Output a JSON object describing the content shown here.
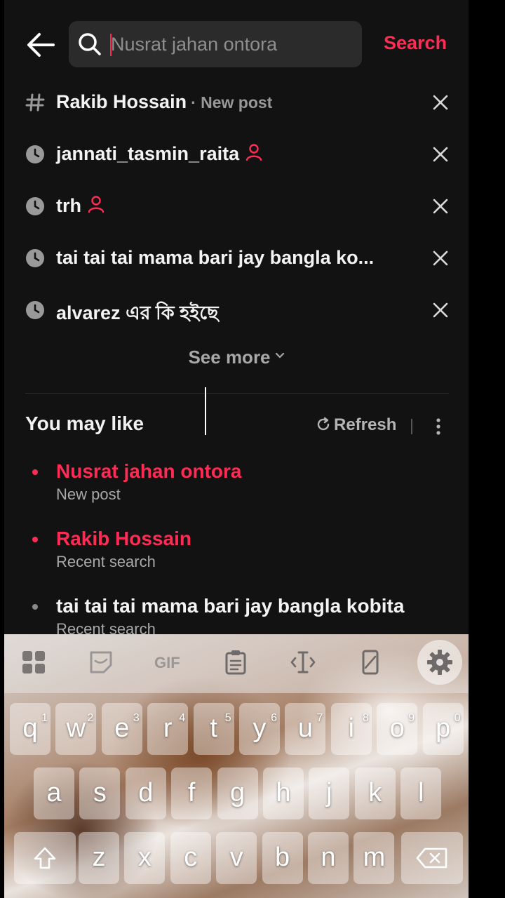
{
  "search": {
    "placeholder": "Nusrat jahan ontora",
    "button_label": "Search"
  },
  "history": [
    {
      "icon": "hashtag-icon",
      "text": "Rakib Hossain",
      "sub": "· New post",
      "has_user_icon": false
    },
    {
      "icon": "clock-icon",
      "text": "jannati_tasmin_raita",
      "sub": "",
      "has_user_icon": true
    },
    {
      "icon": "clock-icon",
      "text": "trh",
      "sub": "",
      "has_user_icon": true
    },
    {
      "icon": "clock-icon",
      "text": "tai tai tai mama bari jay bangla ko...",
      "sub": "",
      "has_user_icon": false
    },
    {
      "icon": "clock-icon",
      "text": "alvarez এর কি হইছে",
      "sub": "",
      "has_user_icon": false
    }
  ],
  "see_more_label": "See more",
  "you_may_like": {
    "title": "You may like",
    "refresh_label": "Refresh",
    "items": [
      {
        "title": "Nusrat jahan ontora",
        "sub": "New post",
        "highlight": true
      },
      {
        "title": "Rakib Hossain",
        "sub": "Recent search",
        "highlight": true
      },
      {
        "title": "tai tai tai mama bari jay bangla kobita",
        "sub": "Recent search",
        "highlight": false
      }
    ]
  },
  "keyboard": {
    "toolbar": [
      "apps-icon",
      "sticker-icon",
      "GIF",
      "clipboard-icon",
      "text-cursor-icon",
      "one-handed-icon",
      "gear-icon"
    ],
    "gif_label": "GIF",
    "row1": [
      {
        "k": "q",
        "n": "1"
      },
      {
        "k": "w",
        "n": "2"
      },
      {
        "k": "e",
        "n": "3"
      },
      {
        "k": "r",
        "n": "4"
      },
      {
        "k": "t",
        "n": "5"
      },
      {
        "k": "y",
        "n": "6"
      },
      {
        "k": "u",
        "n": "7"
      },
      {
        "k": "i",
        "n": "8"
      },
      {
        "k": "o",
        "n": "9"
      },
      {
        "k": "p",
        "n": "0"
      }
    ],
    "row2": [
      "a",
      "s",
      "d",
      "f",
      "g",
      "h",
      "j",
      "k",
      "l"
    ],
    "row3": [
      "z",
      "x",
      "c",
      "v",
      "b",
      "n",
      "m"
    ]
  },
  "colors": {
    "accent": "#fe2c55",
    "background": "#131213",
    "searchbox": "#2c2b2c"
  }
}
